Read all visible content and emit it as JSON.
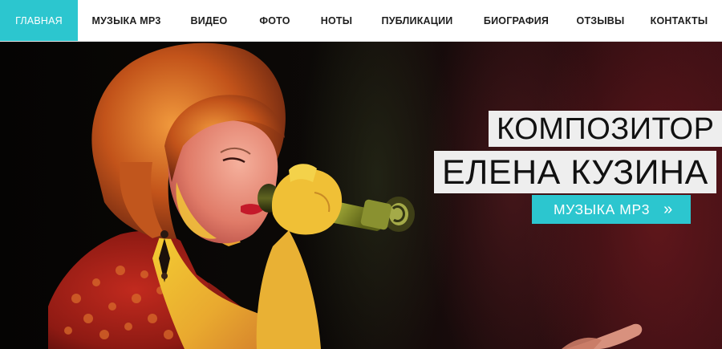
{
  "nav": {
    "items": [
      {
        "label": "ГЛАВНАЯ",
        "active": true
      },
      {
        "label": "МУЗЫКА MP3"
      },
      {
        "label": "ВИДЕО"
      },
      {
        "label": "ФОТО"
      },
      {
        "label": "НОТЫ"
      },
      {
        "label": "ПУБЛИКАЦИИ"
      },
      {
        "label": "БИОГРАФИЯ"
      },
      {
        "label": "ОТЗЫВЫ"
      },
      {
        "label": "КОНТАКТЫ"
      }
    ]
  },
  "hero": {
    "title_line1": "КОМПОЗИТОР",
    "title_line2": "ЕЛЕНА КУЗИНА",
    "cta_label": "МУЗЫКА MP3",
    "cta_arrow": "»",
    "photo_icon": "singer-with-microphone-photo"
  },
  "colors": {
    "accent": "#2cc6cf",
    "title_bg": "#eeeeee",
    "title_text": "#111111"
  }
}
